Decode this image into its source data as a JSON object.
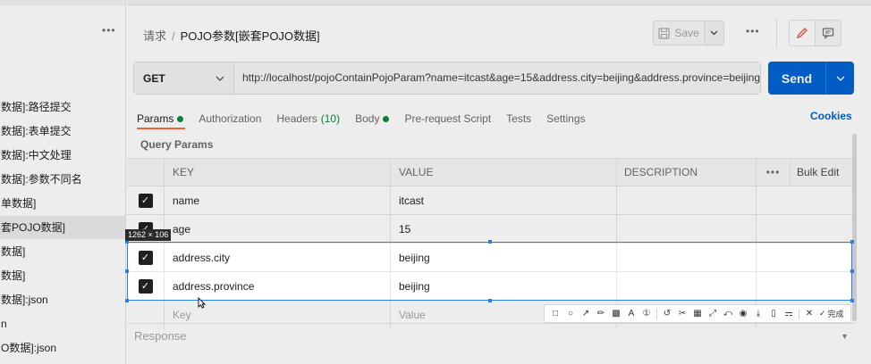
{
  "sidebar": {
    "more_label": "•••",
    "items": [
      {
        "label": "数据]:路径提交",
        "active": false
      },
      {
        "label": "数据]:表单提交",
        "active": false
      },
      {
        "label": "数据]:中文处理",
        "active": false
      },
      {
        "label": "数据]:参数不同名",
        "active": false
      },
      {
        "label": "单数据]",
        "active": false
      },
      {
        "label": "套POJO数据]",
        "active": true
      },
      {
        "label": "数据]",
        "active": false
      },
      {
        "label": "数据]",
        "active": false
      },
      {
        "label": "数据]:json",
        "active": false
      },
      {
        "label": "n",
        "active": false
      },
      {
        "label": "O数据]:json",
        "active": false
      }
    ]
  },
  "header": {
    "breadcrumb_parent": "请求",
    "breadcrumb_sep": "/",
    "title": "POJO参数[嵌套POJO数据]",
    "save_label": "Save",
    "more_label": "•••"
  },
  "request": {
    "method": "GET",
    "url": "http://localhost/pojoContainPojoParam?name=itcast&age=15&address.city=beijing&address.province=beijing",
    "send_label": "Send"
  },
  "tabs": [
    {
      "label": "Params",
      "count": "",
      "dot": true,
      "active": true
    },
    {
      "label": "Authorization",
      "count": "",
      "dot": false,
      "active": false
    },
    {
      "label": "Headers",
      "count": "(10)",
      "dot": false,
      "active": false
    },
    {
      "label": "Body",
      "count": "",
      "dot": true,
      "active": false
    },
    {
      "label": "Pre-request Script",
      "count": "",
      "dot": false,
      "active": false
    },
    {
      "label": "Tests",
      "count": "",
      "dot": false,
      "active": false
    },
    {
      "label": "Settings",
      "count": "",
      "dot": false,
      "active": false
    }
  ],
  "cookies_label": "Cookies",
  "query_params": {
    "title": "Query Params",
    "columns": {
      "key": "KEY",
      "value": "VALUE",
      "description": "DESCRIPTION",
      "more": "•••",
      "bulk_edit": "Bulk Edit"
    },
    "rows": [
      {
        "checked": true,
        "key": "name",
        "value": "itcast",
        "description": ""
      },
      {
        "checked": true,
        "key": "age",
        "value": "15",
        "description": ""
      },
      {
        "checked": true,
        "key": "address.city",
        "value": "beijing",
        "description": ""
      },
      {
        "checked": true,
        "key": "address.province",
        "value": "beijing",
        "description": ""
      }
    ],
    "placeholder_key": "Key",
    "placeholder_value": "Value"
  },
  "capture": {
    "size_label": "1262 × 106",
    "done_label": "完成"
  },
  "response": {
    "title": "Response"
  },
  "colors": {
    "send": "#0265d2",
    "accent_tab": "#ff6c37",
    "dot": "#0a8a3a",
    "cookies": "#0265d2"
  }
}
